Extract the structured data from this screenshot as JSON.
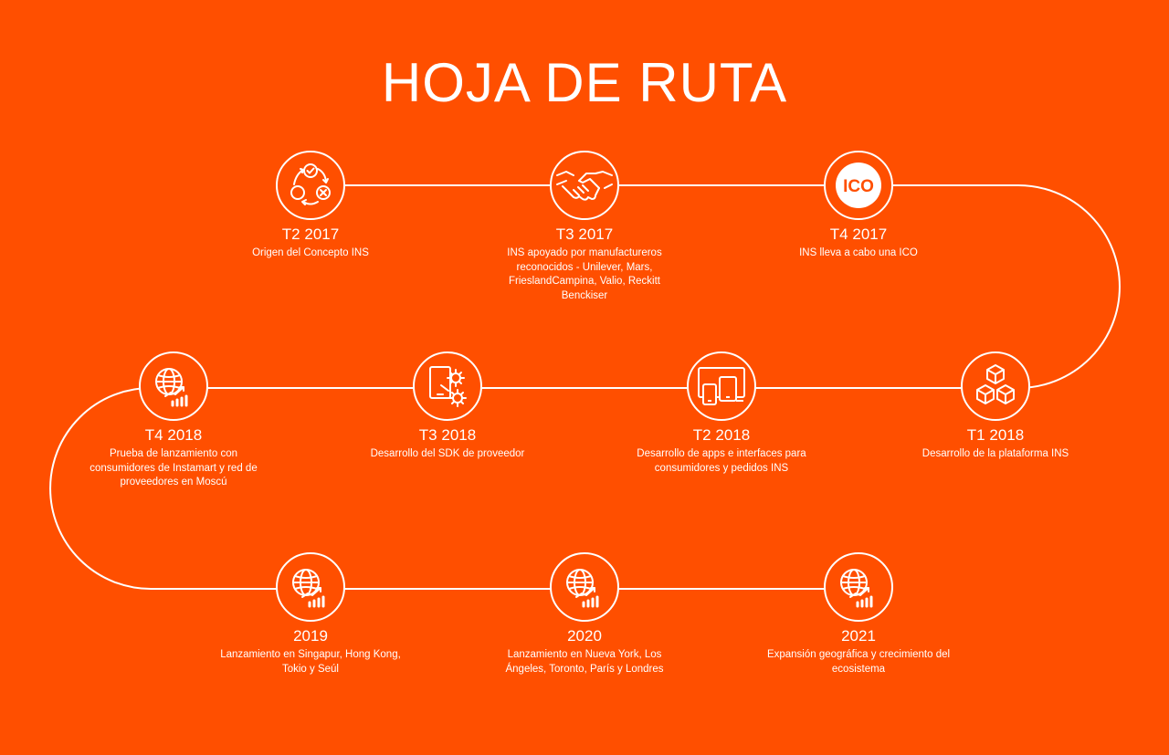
{
  "title": "HOJA DE RUTA",
  "colors": {
    "background": "#FF4F00",
    "line": "#ffffff"
  },
  "milestones": [
    {
      "period": "T2 2017",
      "description": "Origen del Concepto INS",
      "icon": "concept-cycle-icon"
    },
    {
      "period": "T3 2017",
      "description": "INS apoyado por manufactureros reconocidos - Unilever, Mars, FrieslandCampina, Valio, Reckitt Benckiser",
      "icon": "handshake-icon"
    },
    {
      "period": "T4 2017",
      "description": "INS lleva a cabo una ICO",
      "icon": "ico-badge-icon",
      "icon_text": "ICO"
    },
    {
      "period": "T1 2018",
      "description": "Desarrollo de la plataforma INS",
      "icon": "blocks-cubes-icon"
    },
    {
      "period": "T2 2018",
      "description": "Desarrollo de apps e interfaces para consumidores y pedidos INS",
      "icon": "devices-icon"
    },
    {
      "period": "T3 2018",
      "description": "Desarrollo del SDK de proveedor",
      "icon": "sdk-gears-icon"
    },
    {
      "period": "T4 2018",
      "description": "Prueba de lanzamiento con consumidores de Instamart y red de proveedores en Moscú",
      "icon": "globe-growth-icon"
    },
    {
      "period": "2019",
      "description": "Lanzamiento en Singapur, Hong Kong, Tokio y Seúl",
      "icon": "globe-growth-icon"
    },
    {
      "period": "2020",
      "description": "Lanzamiento en Nueva York, Los Ángeles, Toronto, París y Londres",
      "icon": "globe-growth-icon"
    },
    {
      "period": "2021",
      "description": "Expansión geográfica y crecimiento del ecosistema",
      "icon": "globe-growth-icon"
    }
  ]
}
